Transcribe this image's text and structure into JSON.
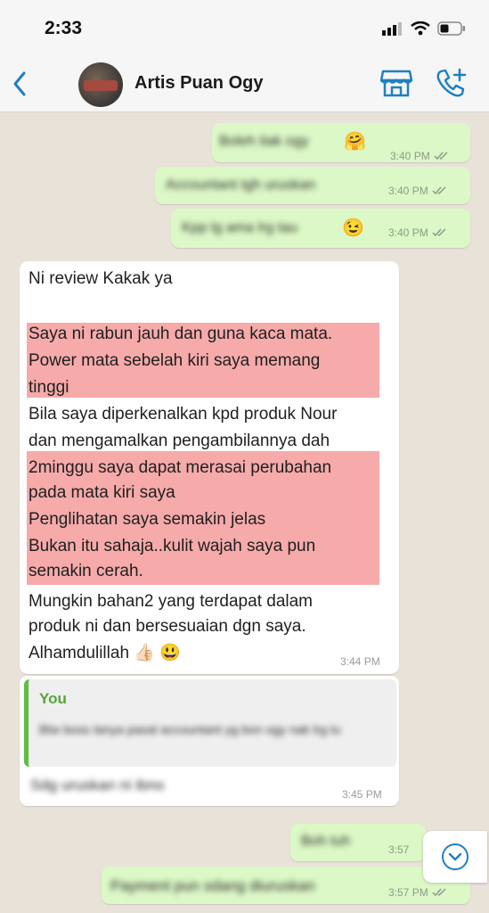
{
  "status_bar": {
    "time": "2:33"
  },
  "header": {
    "contact_name": "Artis Puan Ogy"
  },
  "messages_top": [
    {
      "text": "Boleh tiak ogy",
      "emoji": "🤗",
      "time": "3:40 PM"
    },
    {
      "text": "Accountant tgh uruskan",
      "time": "3:40 PM"
    },
    {
      "text": "Kpp lg ama lrg tau",
      "emoji": "😉",
      "time": "3:40 PM"
    }
  ],
  "review": {
    "lines": [
      "Ni review Kakak ya",
      "",
      "Saya ni rabun jauh dan guna kaca mata.",
      "Power mata sebelah kiri saya memang",
      "tinggi",
      "Bila saya diperkenalkan kpd produk Nour",
      "dan mengamalkan pengambilannya dah",
      "2minggu saya dapat merasai perubahan",
      "pada mata kiri saya",
      "Penglihatan saya semakin jelas",
      "Bukan itu sahaja..kulit wajah saya pun",
      "semakin cerah.",
      "Mungkin bahan2 yang terdapat dalam",
      "produk ni dan bersesuaian dgn saya.",
      "Alhamdulillah 👍🏻 😃"
    ],
    "time": "3:44 PM"
  },
  "reply": {
    "quote_author": "You",
    "quote_text": "Btw boss tanya pasal accountant yg bon ogy nak lrg tu",
    "text": "Sdg uruskan ni ibno",
    "time": "3:45 PM"
  },
  "messages_bottom": [
    {
      "text": "Boh tuh",
      "time": "3:57"
    },
    {
      "text": "Payment pun sdang diuruskan",
      "time": "3:57 PM"
    }
  ],
  "colors": {
    "accent": "#1e7fc2",
    "outgoing_bubble": "#dcf8c6",
    "highlight": "#f6aaaa",
    "quote_bar": "#5fbd3f"
  }
}
